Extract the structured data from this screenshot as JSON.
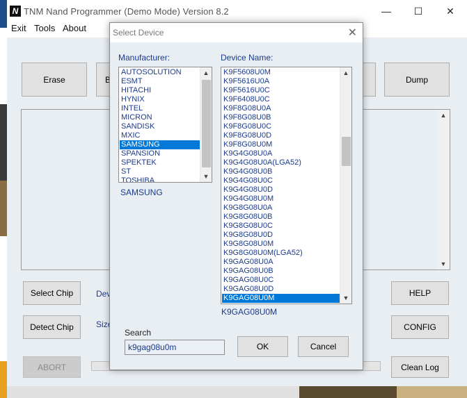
{
  "window": {
    "title": "TNM  Nand Programmer  (Demo Mode)   Version 8.2",
    "icon_glyph": "N",
    "minimize_glyph": "—",
    "maximize_glyph": "☐",
    "close_glyph": "✕"
  },
  "menu": [
    "Exit",
    "Tools",
    "About"
  ],
  "main": {
    "buttons": {
      "erase": "Erase",
      "b_partial": "B",
      "dump": "Dump",
      "select_chip": "Select Chip",
      "detect_chip": "Detect Chip",
      "abort": "ABORT",
      "help": "HELP",
      "config": "CONFIG",
      "clean_log": "Clean Log"
    },
    "labels": {
      "device_partial": "Dev",
      "size_partial": "Size"
    }
  },
  "dialog": {
    "title": "Select Device",
    "close_glyph": "✕",
    "manufacturer_label": "Manufacturer:",
    "device_label": "Device Name:",
    "manufacturers": [
      "AUTOSOLUTION",
      "ESMT",
      "HITACHI",
      "HYNIX",
      "INTEL",
      "MICRON",
      "SANDISK",
      "MXIC",
      "SAMSUNG",
      "SPANSION",
      "SPEKTEK",
      "ST",
      "TOSHIBA"
    ],
    "selected_manufacturer_index": 8,
    "selected_manufacturer": "SAMSUNG",
    "devices": [
      "K9F5608U0M",
      "K9F5616U0A",
      "K9F5616U0C",
      "K9F6408U0C",
      "K9F8G08U0A",
      "K9F8G08U0B",
      "K9F8G08U0C",
      "K9F8G08U0D",
      "K9F8G08U0M",
      "K9G4G08U0A",
      "K9G4G08U0A(LGA52)",
      "K9G4G08U0B",
      "K9G4G08U0C",
      "K9G4G08U0D",
      "K9G4G08U0M",
      "K9G8G08U0A",
      "K9G8G08U0B",
      "K9G8G08U0C",
      "K9G8G08U0D",
      "K9G8G08U0M",
      "K9G8G08U0M(LGA52)",
      "K9GAG08U0A",
      "K9GAG08U0B",
      "K9GAG08U0C",
      "K9GAG08U0D",
      "K9GAG08U0M"
    ],
    "selected_device_index": 25,
    "selected_device": "K9GAG08U0M",
    "search_label": "Search",
    "search_value": "k9gag08u0m",
    "ok_label": "OK",
    "cancel_label": "Cancel"
  }
}
